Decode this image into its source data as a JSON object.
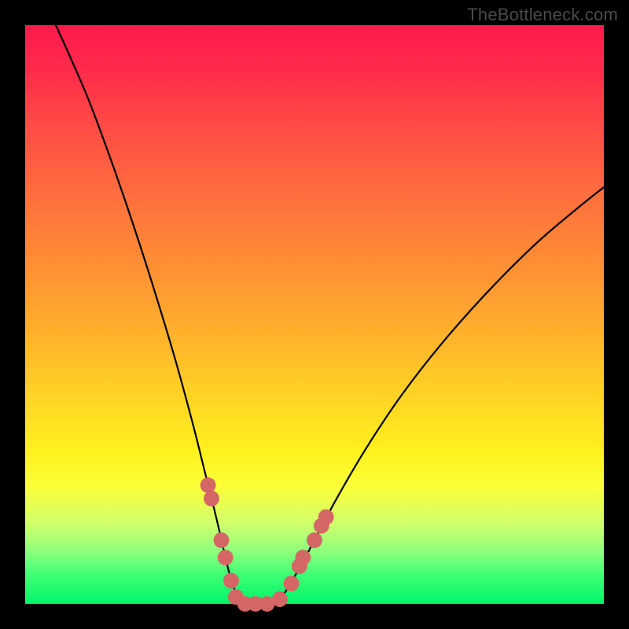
{
  "watermark": {
    "text": "TheBottleneck.com"
  },
  "chart_data": {
    "type": "line",
    "title": "",
    "xlabel": "",
    "ylabel": "",
    "xlim": [
      0,
      1
    ],
    "ylim": [
      0,
      1
    ],
    "curve_left": [
      {
        "x": 0.053,
        "y": 1.0
      },
      {
        "x": 0.08,
        "y": 0.94
      },
      {
        "x": 0.11,
        "y": 0.87
      },
      {
        "x": 0.14,
        "y": 0.79
      },
      {
        "x": 0.17,
        "y": 0.705
      },
      {
        "x": 0.2,
        "y": 0.615
      },
      {
        "x": 0.23,
        "y": 0.52
      },
      {
        "x": 0.26,
        "y": 0.42
      },
      {
        "x": 0.29,
        "y": 0.31
      },
      {
        "x": 0.31,
        "y": 0.23
      },
      {
        "x": 0.33,
        "y": 0.15
      },
      {
        "x": 0.345,
        "y": 0.085
      },
      {
        "x": 0.358,
        "y": 0.035
      },
      {
        "x": 0.372,
        "y": 0.01
      },
      {
        "x": 0.39,
        "y": 0.0
      }
    ],
    "curve_right": [
      {
        "x": 0.39,
        "y": 0.0
      },
      {
        "x": 0.42,
        "y": 0.0
      },
      {
        "x": 0.445,
        "y": 0.015
      },
      {
        "x": 0.47,
        "y": 0.055
      },
      {
        "x": 0.5,
        "y": 0.11
      },
      {
        "x": 0.54,
        "y": 0.185
      },
      {
        "x": 0.59,
        "y": 0.27
      },
      {
        "x": 0.65,
        "y": 0.36
      },
      {
        "x": 0.72,
        "y": 0.45
      },
      {
        "x": 0.8,
        "y": 0.54
      },
      {
        "x": 0.88,
        "y": 0.62
      },
      {
        "x": 0.95,
        "y": 0.68
      },
      {
        "x": 1.0,
        "y": 0.72
      }
    ],
    "dots_xy": [
      {
        "x": 0.316,
        "y": 0.205
      },
      {
        "x": 0.322,
        "y": 0.182
      },
      {
        "x": 0.339,
        "y": 0.11
      },
      {
        "x": 0.346,
        "y": 0.08
      },
      {
        "x": 0.356,
        "y": 0.04
      },
      {
        "x": 0.364,
        "y": 0.012
      },
      {
        "x": 0.38,
        "y": 0.0
      },
      {
        "x": 0.398,
        "y": 0.0
      },
      {
        "x": 0.418,
        "y": 0.0
      },
      {
        "x": 0.44,
        "y": 0.008
      },
      {
        "x": 0.46,
        "y": 0.035
      },
      {
        "x": 0.474,
        "y": 0.065
      },
      {
        "x": 0.48,
        "y": 0.08
      },
      {
        "x": 0.5,
        "y": 0.11
      },
      {
        "x": 0.512,
        "y": 0.135
      },
      {
        "x": 0.52,
        "y": 0.15
      }
    ],
    "dot_radius": 0.0135,
    "dot_color": "#d46666",
    "curve_color": "#000000",
    "background_gradient": {
      "top": "#ff1a4d",
      "mid": "#ffd324",
      "bottom": "#00f56a"
    }
  }
}
